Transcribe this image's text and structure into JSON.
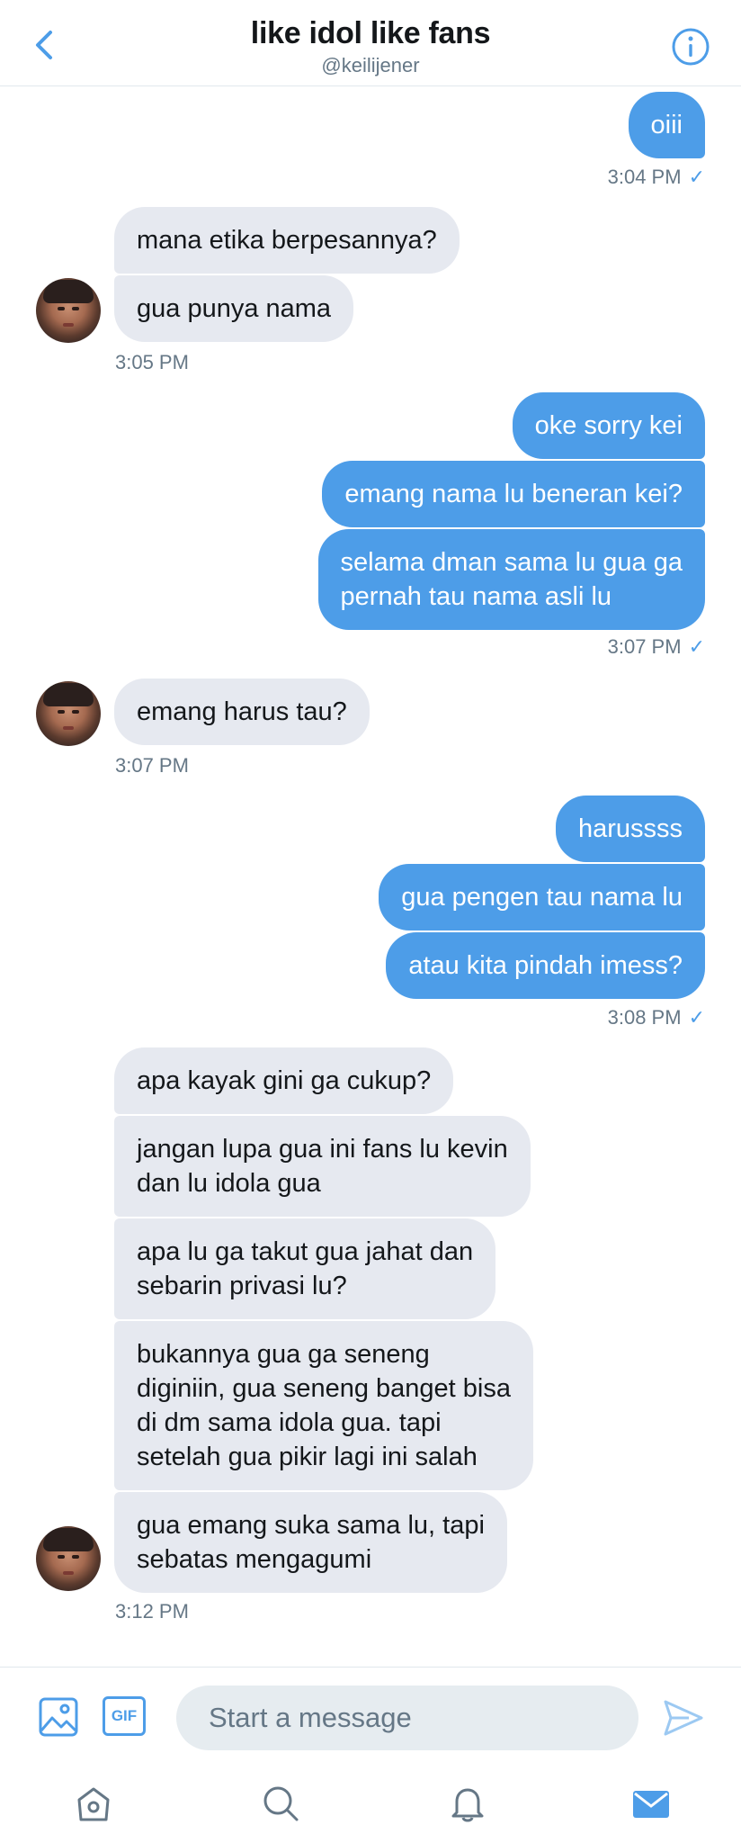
{
  "header": {
    "title": "like idol like fans",
    "handle": "@keilijener"
  },
  "colors": {
    "accent": "#4d9de8",
    "incoming_bubble": "#e6e9f0",
    "secondary_text": "#657786"
  },
  "messages": [
    {
      "direction": "out",
      "text": "oiii"
    },
    {
      "direction": "time-out",
      "text": "3:04 PM",
      "read_mark": "✓"
    },
    {
      "direction": "in",
      "text": "mana etika berpesannya?"
    },
    {
      "direction": "in",
      "text": "gua punya nama"
    },
    {
      "direction": "time-in",
      "text": "3:05 PM"
    },
    {
      "direction": "out",
      "text": "oke sorry kei"
    },
    {
      "direction": "out",
      "text": "emang nama lu beneran kei?"
    },
    {
      "direction": "out",
      "text": "selama dman sama lu gua ga\npernah tau nama asli lu"
    },
    {
      "direction": "time-out",
      "text": "3:07 PM",
      "read_mark": "✓"
    },
    {
      "direction": "in",
      "text": "emang harus tau?"
    },
    {
      "direction": "time-in",
      "text": "3:07 PM"
    },
    {
      "direction": "out",
      "text": "harussss"
    },
    {
      "direction": "out",
      "text": "gua pengen tau nama lu"
    },
    {
      "direction": "out",
      "text": "atau kita pindah imess?"
    },
    {
      "direction": "time-out",
      "text": "3:08 PM",
      "read_mark": "✓"
    },
    {
      "direction": "in",
      "text": "apa kayak gini ga cukup?"
    },
    {
      "direction": "in",
      "text": "jangan lupa gua ini fans lu kevin\ndan lu idola gua"
    },
    {
      "direction": "in",
      "text": "apa lu ga takut gua jahat dan\nsebarin privasi lu?"
    },
    {
      "direction": "in",
      "text": "bukannya gua ga seneng\ndiginiin, gua seneng banget bisa\ndi dm sama idola gua. tapi\nsetelah gua pikir lagi ini salah"
    },
    {
      "direction": "in",
      "text": "gua emang suka sama lu, tapi\nsebatas mengagumi"
    },
    {
      "direction": "time-in",
      "text": "3:12 PM"
    }
  ],
  "composer": {
    "placeholder": "Start a message",
    "gif_label": "GIF",
    "icons": [
      "image-icon",
      "gif-icon",
      "send-icon"
    ]
  },
  "tabbar": {
    "icons": [
      "home-icon",
      "search-icon",
      "bell-icon",
      "mail-icon"
    ],
    "active": "mail-icon"
  }
}
